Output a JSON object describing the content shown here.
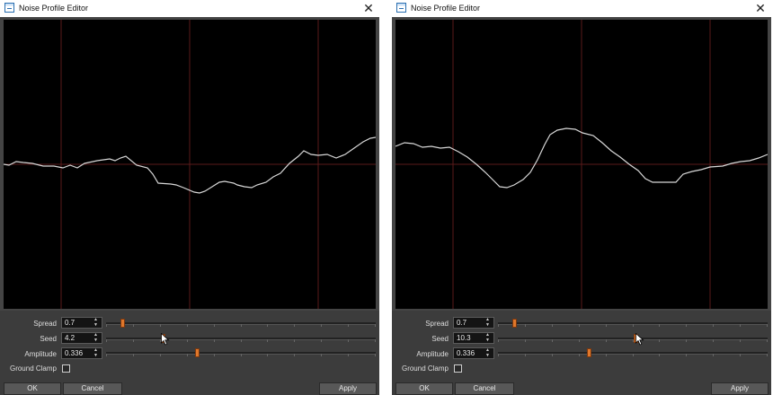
{
  "windows": [
    {
      "title": "Noise Profile Editor",
      "close_icon": "close-icon",
      "params": {
        "spread": {
          "label": "Spread",
          "value": "0.7",
          "slider": 0.06
        },
        "seed": {
          "label": "Seed",
          "value": "4.2",
          "slider": 0.21
        },
        "amplitude": {
          "label": "Amplitude",
          "value": "0.336",
          "slider": 0.335
        }
      },
      "ground_clamp": {
        "label": "Ground Clamp",
        "checked": false
      },
      "buttons": {
        "ok": "OK",
        "cancel": "Cancel",
        "apply": "Apply"
      },
      "graph_color": "#d8d8d8"
    },
    {
      "title": "Noise Profile Editor",
      "close_icon": "close-icon",
      "params": {
        "spread": {
          "label": "Spread",
          "value": "0.7",
          "slider": 0.06
        },
        "seed": {
          "label": "Seed",
          "value": "10.3",
          "slider": 0.51
        },
        "amplitude": {
          "label": "Amplitude",
          "value": "0.336",
          "slider": 0.335
        }
      },
      "ground_clamp": {
        "label": "Ground Clamp",
        "checked": false
      },
      "buttons": {
        "ok": "OK",
        "cancel": "Cancel",
        "apply": "Apply"
      },
      "graph_color": "#d8d8d8"
    }
  ],
  "colors": {
    "slider_thumb": "#e0772a",
    "grid_lines": "#5a1a1a",
    "graph_background": "#000000"
  }
}
